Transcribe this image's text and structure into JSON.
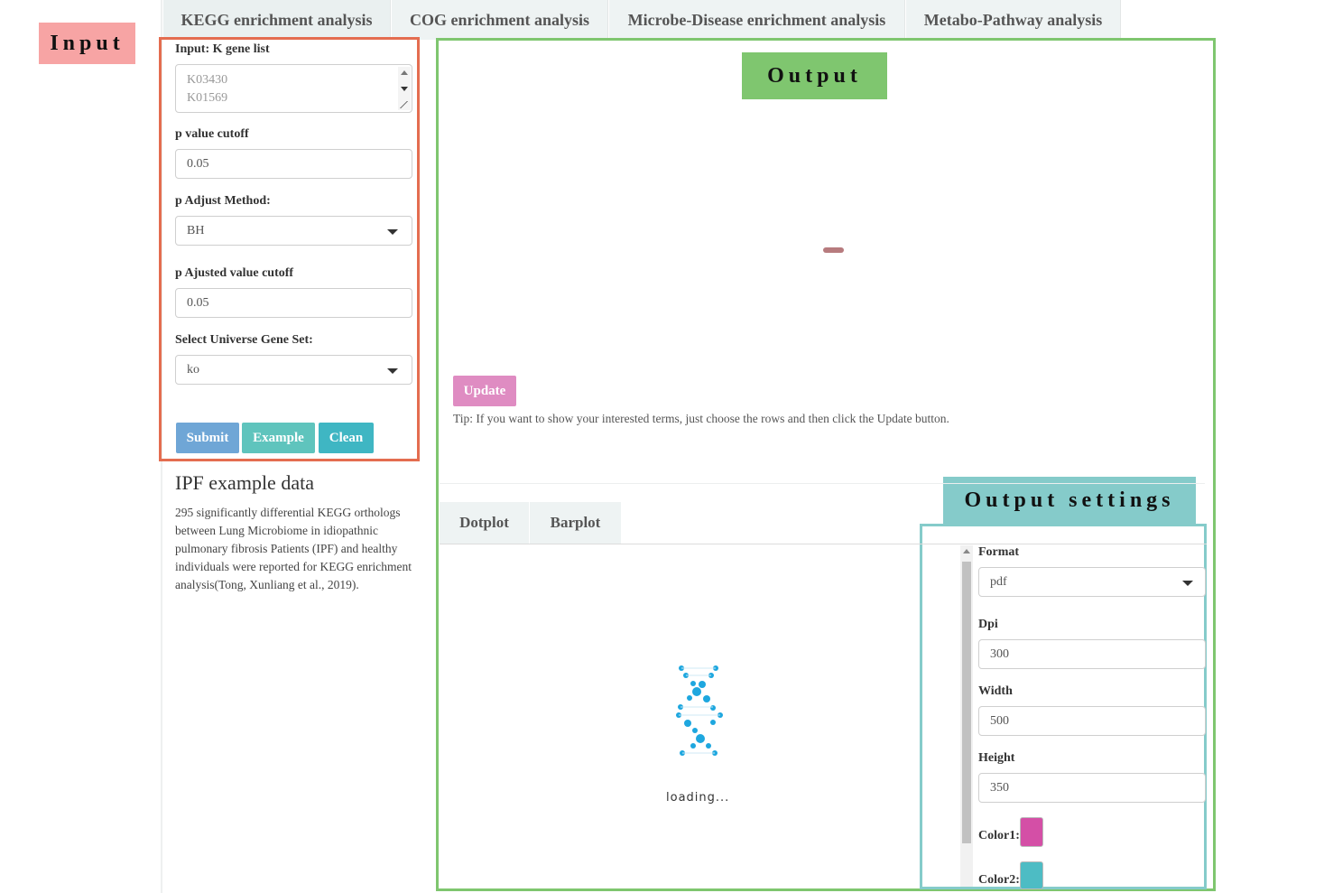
{
  "tabs": [
    "KEGG enrichment analysis",
    "COG enrichment analysis",
    "Microbe-Disease enrichment analysis",
    "Metabo-Pathway analysis"
  ],
  "annotations": {
    "input": "Input",
    "output": "Output",
    "output_settings": "Output settings"
  },
  "form": {
    "gene_list_label": "Input: K gene list",
    "gene_list_lines": [
      "K03430",
      "K01569"
    ],
    "pvalue_label": "p value cutoff",
    "pvalue": "0.05",
    "adjust_label": "p Adjust Method:",
    "adjust_value": "BH",
    "padj_label": "p Ajusted value cutoff",
    "padj": "0.05",
    "universe_label": "Select Universe Gene Set:",
    "universe_value": "ko",
    "submit": "Submit",
    "example": "Example",
    "clean": "Clean"
  },
  "example_info": {
    "title": "IPF example data",
    "text": "295 significantly differential KEGG orthologs between Lung Microbiome in idiopathnic pulmonary fibrosis Patients (IPF) and healthy individuals were reported for KEGG enrichment analysis(Tong, Xunliang et al., 2019)."
  },
  "output": {
    "update": "Update",
    "tip": "Tip: If you want to show your interested terms, just choose the rows and then click the Update button.",
    "plot_tabs": [
      "Dotplot",
      "Barplot"
    ],
    "loading": "loading..."
  },
  "settings": {
    "format_label": "Format",
    "format_value": "pdf",
    "dpi_label": "Dpi",
    "dpi": "300",
    "width_label": "Width",
    "width": "500",
    "height_label": "Height",
    "height": "350",
    "color1_label": "Color1:",
    "color1": "#d44fa6",
    "color2_label": "Color2:",
    "color2": "#4dbcc4"
  },
  "colors": {
    "submit_bg": "#6fa6d6",
    "example_bg": "#5fc4bd",
    "clean_bg": "#3fb6c3",
    "update_bg": "#df8cc2",
    "loading_icon": "#1ea7df",
    "spinner_dash": "#b77b7e"
  }
}
